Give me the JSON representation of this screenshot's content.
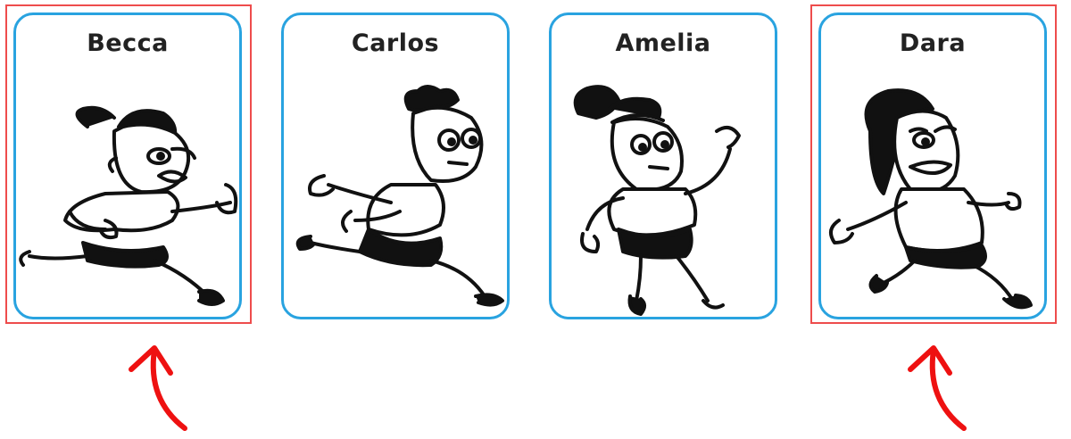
{
  "cards": [
    {
      "name": "Becca",
      "figure": "running-girl-ponytail",
      "highlighted": true
    },
    {
      "name": "Carlos",
      "figure": "running-boy-curly-hair",
      "highlighted": false
    },
    {
      "name": "Amelia",
      "figure": "running-girl-bun",
      "highlighted": false
    },
    {
      "name": "Dara",
      "figure": "running-girl-long-hair",
      "highlighted": true
    }
  ],
  "colors": {
    "card_border": "#29a3e0",
    "highlight": "#ee4c4c",
    "arrow": "#ee1111"
  },
  "icons": [
    "up-arrow-icon"
  ]
}
